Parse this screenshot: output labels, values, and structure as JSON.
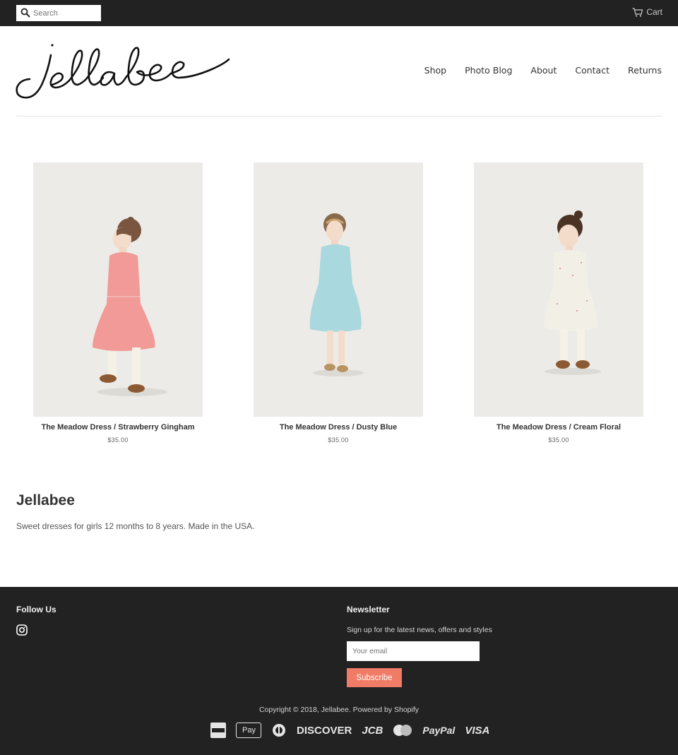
{
  "topbar": {
    "search_placeholder": "Search",
    "cart_label": "Cart"
  },
  "header": {
    "logo_text": "Jellabee",
    "nav": [
      "Shop",
      "Photo Blog",
      "About",
      "Contact",
      "Returns"
    ]
  },
  "products": [
    {
      "title": "The Meadow Dress / Strawberry Gingham",
      "price": "$35.00",
      "dress_color": "#f19a97"
    },
    {
      "title": "The Meadow Dress / Dusty Blue",
      "price": "$35.00",
      "dress_color": "#a9d8df"
    },
    {
      "title": "The Meadow Dress / Cream Floral",
      "price": "$35.00",
      "dress_color": "#f2efe7"
    }
  ],
  "about": {
    "title": "Jellabee",
    "text": "Sweet dresses for girls 12 months to 8 years. Made in the USA."
  },
  "footer": {
    "follow_heading": "Follow Us",
    "newsletter_heading": "Newsletter",
    "newsletter_text": "Sign up for the latest news, offers and styles",
    "email_placeholder": "Your email",
    "subscribe_label": "Subscribe",
    "copyright": "Copyright © 2018, Jellabee. Powered by Shopify",
    "payments": {
      "discover": "DISCOVER",
      "jcb": "JCB",
      "paypal": "PayPal",
      "visa": "VISA",
      "applepay": "Pay"
    }
  },
  "colors": {
    "topbar_bg": "#222222",
    "footer_bg": "#222222",
    "accent": "#f07b66"
  }
}
